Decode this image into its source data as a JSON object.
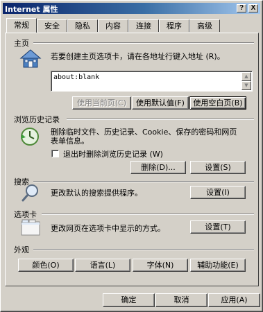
{
  "window": {
    "title": "Internet 属性",
    "help_btn": "?",
    "close_btn": "X"
  },
  "tabs": [
    {
      "label": "常规",
      "active": true
    },
    {
      "label": "安全",
      "active": false
    },
    {
      "label": "隐私",
      "active": false
    },
    {
      "label": "内容",
      "active": false
    },
    {
      "label": "连接",
      "active": false
    },
    {
      "label": "程序",
      "active": false
    },
    {
      "label": "高级",
      "active": false
    }
  ],
  "homepage": {
    "title": "主页",
    "description": "若要创建主页选项卡，请在各地址行键入地址 (R)。",
    "value": "about:blank",
    "use_current": "使用当前页(C)",
    "use_default": "使用默认值(F)",
    "use_blank": "使用空白页(B)"
  },
  "history": {
    "title": "浏览历史记录",
    "description_line1": "删除临时文件、历史记录、Cookie、保存的密码和网页",
    "description_line2": "表单信息。",
    "checkbox_label": "退出时删除浏览历史记录 (W)",
    "delete": "删除(D)...",
    "settings": "设置(S)"
  },
  "search": {
    "title": "搜索",
    "description": "更改默认的搜索提供程序。",
    "settings": "设置(I)"
  },
  "tabs_section": {
    "title": "选项卡",
    "description": "更改网页在选项卡中显示的方式。",
    "settings": "设置(T)"
  },
  "appearance": {
    "title": "外观",
    "colors": "颜色(O)",
    "languages": "语言(L)",
    "fonts": "字体(N)",
    "accessibility": "辅助功能(E)"
  },
  "footer": {
    "ok": "确定",
    "cancel": "取消",
    "apply": "应用(A)"
  }
}
